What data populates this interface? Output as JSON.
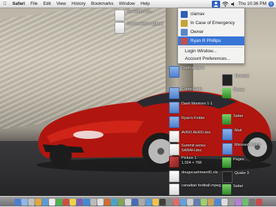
{
  "menubar": {
    "app": "Safari",
    "items": [
      "File",
      "Edit",
      "View",
      "History",
      "Bookmarks",
      "Window",
      "Help"
    ],
    "clock": "Thu 10:36 PM"
  },
  "user_menu": {
    "users": [
      {
        "name": "clamav",
        "color": "#2f5fb8"
      },
      {
        "name": "In Case of Emergency",
        "color": "#c7a23a"
      },
      {
        "name": "Owner",
        "color": "#5b86c9"
      },
      {
        "name": "Ryan R Phillips",
        "color": "#c0504d",
        "selected": true
      }
    ],
    "login_window": "Login Window...",
    "account_prefs": "Account Preferences..."
  },
  "desktop_icons": {
    "left": [
      {
        "label": "Screenshot to...",
        "type": "doc"
      },
      {
        "label": "Screenshot to upload",
        "type": "doc"
      }
    ],
    "mid": [
      {
        "label": "Dash.widgets",
        "type": "folder"
      },
      {
        "label": "Cumb Earth",
        "type": "folder"
      },
      {
        "label": "Dash Monitors 1-1",
        "type": "folder"
      },
      {
        "label": "Ryan's Folder",
        "type": "folder"
      },
      {
        "label": "AVRO AERO.doc",
        "type": "doc"
      },
      {
        "label": "Summit series SARAH.doc",
        "type": "doc"
      },
      {
        "label": "Picture 1 1,024 × 768",
        "type": "img"
      },
      {
        "label": "dougscashmavril1.xls",
        "type": "doc"
      },
      {
        "label": "canadian football.mpeg",
        "type": "doc"
      }
    ],
    "right": [
      {
        "label": "Terminal",
        "type": "dark"
      },
      {
        "label": "iTunes",
        "type": "app"
      },
      {
        "label": "Safari",
        "type": "app"
      },
      {
        "label": "Mail",
        "type": "folder"
      },
      {
        "label": "Microsoft Word",
        "type": "folder"
      },
      {
        "label": "Pages",
        "type": "app"
      },
      {
        "label": "Quake 3",
        "type": "dark"
      },
      {
        "label": "Safari",
        "type": "app"
      }
    ]
  },
  "dock_colors": [
    "#4a7fd0",
    "#8fb7e8",
    "#c0c0c0",
    "#e7a43c",
    "#5a9bd6",
    "#eeeeee",
    "#4db04a",
    "#d24e3f",
    "#f0d24a",
    "#7a5fb3",
    "#3d8bd6",
    "#bbbbbb",
    "#e0e0e0",
    "#cc6d2d",
    "#48a3c9",
    "#7fa557",
    "#d6d6d6",
    "#446bb8",
    "#aaaaaa",
    "#5b9bd6",
    "#f2c34a",
    "#3e3e3e",
    "#8a8a8a",
    "#e06a6a",
    "#62a0e0",
    "#cccccc",
    "#5f7fb0",
    "#9fcf6a",
    "#c8a05a",
    "#4b87d8",
    "#dddddd",
    "#9a9a9a",
    "#b87cd6",
    "#6cbf6c",
    "#777777",
    "#c94a4a"
  ]
}
